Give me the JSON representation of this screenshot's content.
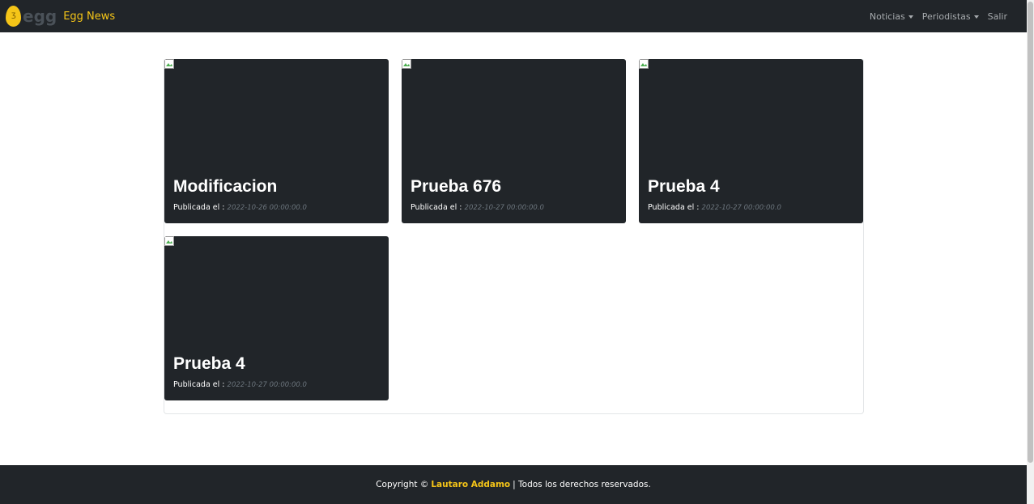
{
  "navbar": {
    "logo_word": "egg",
    "brand_name": "Egg News",
    "links": [
      {
        "label": "Noticias",
        "dropdown": true
      },
      {
        "label": "Periodistas",
        "dropdown": true
      },
      {
        "label": "Salir",
        "dropdown": false
      }
    ]
  },
  "cards": [
    {
      "title": "Modificacion",
      "published_label": "Publicada el :",
      "date": "2022-10-26 00:00:00.0"
    },
    {
      "title": "Prueba 676",
      "published_label": "Publicada el :",
      "date": "2022-10-27 00:00:00.0"
    },
    {
      "title": "Prueba 4",
      "published_label": "Publicada el :",
      "date": "2022-10-27 00:00:00.0"
    },
    {
      "title": "Prueba 4",
      "published_label": "Publicada el :",
      "date": "2022-10-27 00:00:00.0"
    }
  ],
  "footer": {
    "prefix": "Copyright ©",
    "author": "Lautaro Addamo",
    "suffix": "| Todos los derechos reservados."
  },
  "colors": {
    "dark": "#212529",
    "accent": "#f5c518",
    "muted": "#6c757d"
  }
}
